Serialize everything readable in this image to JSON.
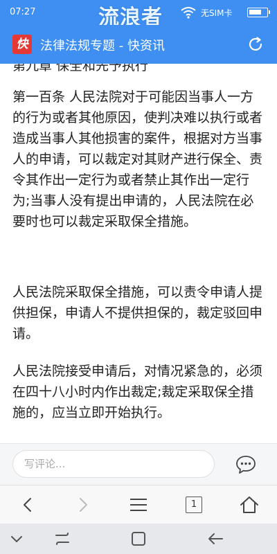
{
  "status_bar": {
    "time": "07:27",
    "watermark": "流浪者",
    "carrier": "无SIM卡",
    "battery_level": 0.75
  },
  "header": {
    "logo_text": "快",
    "title": "法律法规专题 - 快资讯"
  },
  "article": {
    "partial_heading": "第九章 保全和先予执行",
    "paragraphs": [
      "第一百条 人民法院对于可能因当事人一方的行为或者其他原因，使判决难以执行或者造成当事人其他损害的案件，根据对方当事人的申请，可以裁定对其财产进行保全、责令其作出一定行为或者禁止其作出一定行为;当事人没有提出申请的，人民法院在必要时也可以裁定采取保全措施。",
      "人民法院采取保全措施，可以责令申请人提供担保，申请人不提供担保的，裁定驳回申请。",
      "人民法院接受申请后，对情况紧急的，必须在四十八小时内作出裁定;裁定采取保全措施的，应当立即开始执行。"
    ]
  },
  "comment_bar": {
    "placeholder": "写评论..."
  },
  "browser_bar": {
    "tab_count": "1"
  },
  "colors": {
    "header_blue": "#3f8ff2",
    "logo_red": "#e53935"
  }
}
